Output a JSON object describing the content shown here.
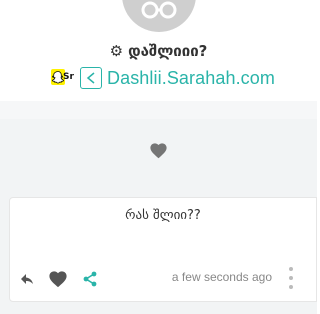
{
  "profile": {
    "name": "დაშლიიი?",
    "link_text": "Dashlii.Sarahah.com"
  },
  "snapchat": {
    "label": "Sr"
  },
  "message": {
    "text": "რას შლიი??",
    "timestamp": "a few seconds ago"
  },
  "colors": {
    "accent": "#2ab4a9",
    "band": "#f2f4f5",
    "avatar": "#cfcfcf",
    "icon_gray": "#666666"
  }
}
